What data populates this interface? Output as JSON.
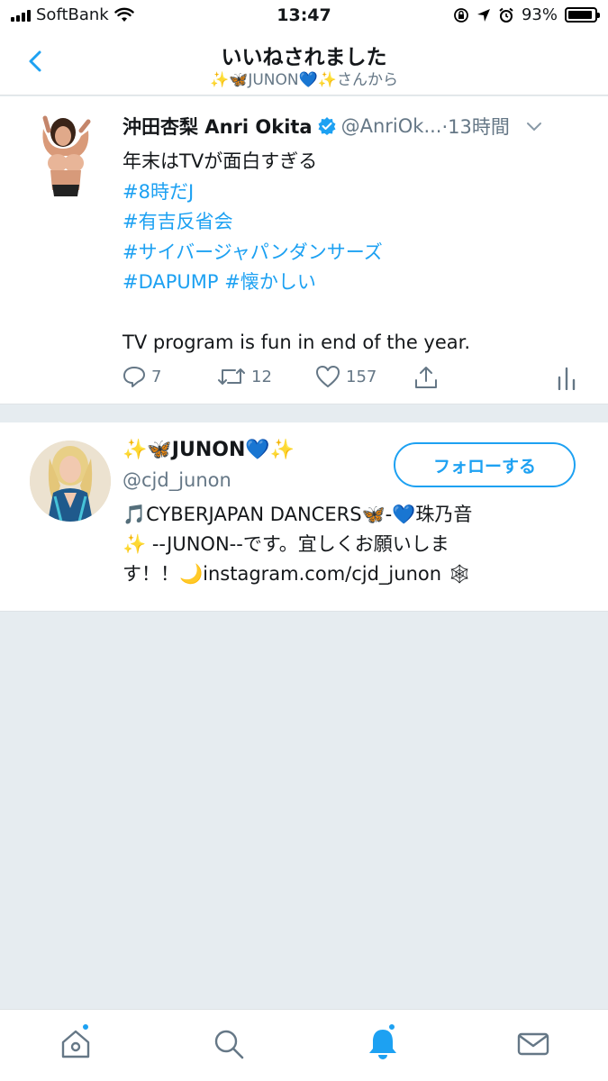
{
  "status_bar": {
    "carrier": "SoftBank",
    "time": "13:47",
    "battery": "93%",
    "battery_level": 0.93
  },
  "header": {
    "title": "いいねされました",
    "subtitle": "✨🦋JUNON💙✨さんから"
  },
  "tweet": {
    "name": "沖田杏梨 Anri Okita",
    "handle": "@AnriOk...",
    "time": "·13時間",
    "lines": [
      {
        "text": "年末はTVが面白すぎる",
        "hashtag": false
      },
      {
        "text": "#8時だJ",
        "hashtag": true
      },
      {
        "text": "#有吉反省会",
        "hashtag": true
      },
      {
        "text": "#サイバージャパンダンサーズ",
        "hashtag": true
      },
      {
        "text": "#DAPUMP #懐かしい",
        "hashtag": true
      },
      {
        "text": "",
        "hashtag": false
      },
      {
        "text": "TV program is fun in end of the year.",
        "hashtag": false
      }
    ],
    "replies": "7",
    "retweets": "12",
    "likes": "157"
  },
  "user": {
    "name": "✨🦋JUNON💙✨",
    "handle": "@cjd_junon",
    "follow_label": "フォローする",
    "bio_lines": [
      "🎵CYBERJAPAN DANCERS🦋-💙珠乃音",
      "✨ --JUNON--です。宜しくお願いしま",
      "す！！🌙instagram.com/cjd_junon 🕸"
    ]
  },
  "colors": {
    "accent": "#1da1f2",
    "secondary_text": "#657786",
    "background": "#e6ecf0"
  },
  "tab_bar": {
    "tabs": [
      "home-icon",
      "search-icon",
      "notifications-icon",
      "messages-icon"
    ],
    "active": "notifications-icon"
  }
}
